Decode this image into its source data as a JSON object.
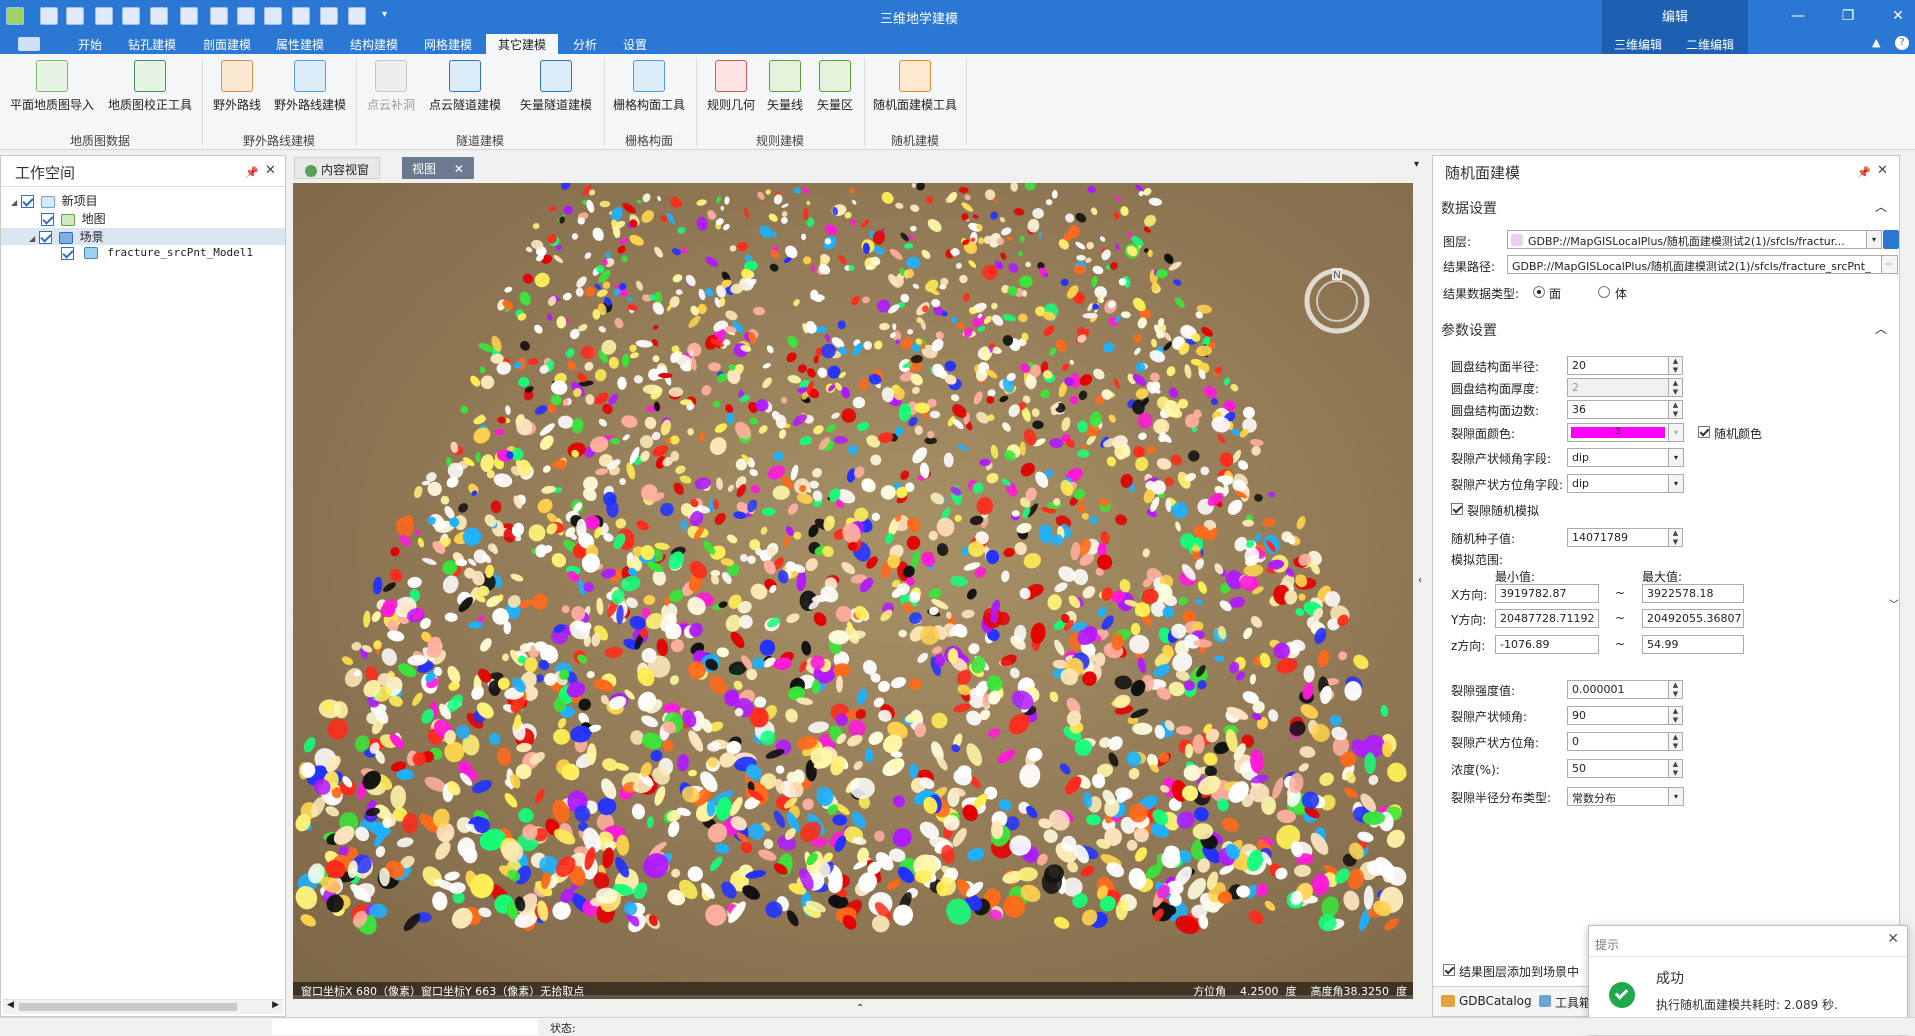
{
  "app": {
    "title": "三维地学建模"
  },
  "context_tab": {
    "title": "编辑",
    "tabs": [
      "三维编辑",
      "二维编辑"
    ]
  },
  "menu": {
    "tabs": [
      "开始",
      "钻孔建模",
      "剖面建模",
      "属性建模",
      "结构建模",
      "网格建模",
      "其它建模",
      "分析",
      "设置"
    ],
    "active": "其它建模"
  },
  "ribbon": {
    "buttons": [
      "平面地质图导入",
      "地质图校正工具",
      "野外路线",
      "野外路线建模",
      "点云补洞",
      "点云隧道建模",
      "矢量隧道建模",
      "栅格构面工具",
      "规则几何",
      "矢量线",
      "矢量区",
      "随机面建模工具"
    ],
    "groups": [
      "地质图数据",
      "野外路线建模",
      "隧道建模",
      "栅格构面",
      "规则建模",
      "随机建模"
    ]
  },
  "workspace": {
    "title": "工作空间",
    "tree": [
      "新项目",
      "地图",
      "场景",
      "fracture_srcPnt_Model1"
    ]
  },
  "doc_tabs": [
    "内容视窗",
    "视图"
  ],
  "viewport": {
    "status_left": "窗口坐标X 680（像素）窗口坐标Y 663（像素）无拾取点",
    "status_right": "方位角    4.2500  度    高度角38.3250  度",
    "compass": "N"
  },
  "panel": {
    "title": "随机面建模",
    "data_section": "数据设置",
    "layer_label": "图层:",
    "layer_value": "GDBP://MapGISLocalPlus/随机面建模测试2(1)/sfcls/fractur...",
    "result_path_label": "结果路径:",
    "result_path_value": "GDBP://MapGISLocalPlus/随机面建模测试2(1)/sfcls/fracture_srcPnt_",
    "result_type_label": "结果数据类型:",
    "result_type_face": "面",
    "result_type_body": "体",
    "param_section": "参数设置",
    "radius_label": "圆盘结构面半径:",
    "radius": "20",
    "thickness_label": "圆盘结构面厚度:",
    "thickness": "2",
    "edges_label": "圆盘结构面边数:",
    "edges": "36",
    "color_label": "裂隙面颜色:",
    "color_index": "3",
    "color_hex": "#ff00ff",
    "random_color": "随机颜色",
    "dip_label": "裂隙产状倾角字段:",
    "dip": "dip",
    "azimuth_field_label": "裂隙产状方位角字段:",
    "azimuth_field": "dip",
    "random_sim": "裂隙随机模拟",
    "seed_label": "随机种子值:",
    "seed": "14071789",
    "range_label": "模拟范围:",
    "min_label": "最小值:",
    "max_label": "最大值:",
    "x_label": "X方向:",
    "x_min": "3919782.87",
    "x_max": "3922578.18",
    "y_label": "Y方向:",
    "y_min": "20487728.71192",
    "y_max": "20492055.36807",
    "z_label": "z方向:",
    "z_min": "-1076.89",
    "z_max": "54.99",
    "tilde": "~",
    "intensity_label": "裂隙强度值:",
    "intensity": "0.000001",
    "dip_angle_label": "裂隙产状倾角:",
    "dip_angle": "90",
    "azimuth_label": "裂隙产状方位角:",
    "azimuth": "0",
    "density_label": "浓度(%):",
    "density": "50",
    "dist_label": "裂隙半径分布类型:",
    "dist": "常数分布",
    "add_to_scene": "结果图层添加到场景中"
  },
  "bottom_tabs": [
    "GDBCatalog",
    "工具箱"
  ],
  "toast": {
    "title": "提示",
    "heading": "成功",
    "message": "执行随机面建模共耗时: 2.089 秒."
  },
  "statusbar": {
    "label": "状态:"
  }
}
